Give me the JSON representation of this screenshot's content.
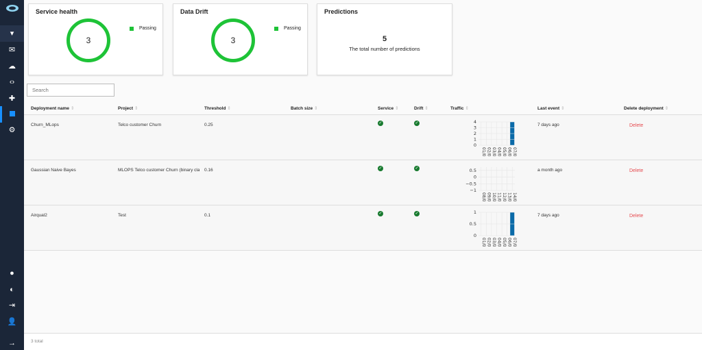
{
  "sidebar": {
    "icons": [
      "logo-icon",
      "dropdown-icon",
      "inbox-icon",
      "cloud-upload-icon",
      "code-icon",
      "puzzle-icon",
      "dashboard-icon",
      "gear-icon",
      "globe-icon",
      "contrast-icon",
      "login-icon",
      "user-icon",
      "arrow-right-icon"
    ]
  },
  "cards": {
    "service_health": {
      "title": "Service health",
      "count": "3",
      "legend": "Passing"
    },
    "data_drift": {
      "title": "Data Drift",
      "count": "3",
      "legend": "Passing"
    },
    "predictions": {
      "title": "Predictions",
      "count": "5",
      "caption": "The total number of predictions"
    }
  },
  "search": {
    "placeholder": "Search"
  },
  "columns": [
    "Deployment name",
    "Project",
    "Threshold",
    "Batch size",
    "Service",
    "Drift",
    "Traffic",
    "Last event",
    "Delete deployment"
  ],
  "rows": [
    {
      "name": "Churn_MLops",
      "project": "Telco customer Churn",
      "threshold": "0.25",
      "batch": "",
      "service": "passing",
      "drift": "passing",
      "last_event": "7 days ago",
      "delete": "Delete",
      "traffic": {
        "type": "bar",
        "x": [
          "01/0",
          "02/0",
          "03/0",
          "04/0",
          "05/0",
          "06/0",
          "07/0"
        ],
        "values": [
          0,
          0,
          0,
          0,
          0,
          0,
          4
        ],
        "yticks": [
          "0",
          "1",
          "2",
          "3",
          "4"
        ],
        "ylim": [
          0,
          4
        ]
      }
    },
    {
      "name": "Gaussian Naive Bayes",
      "project": "MLOPS Telco customer Churn (binary cla",
      "threshold": "0.16",
      "batch": "",
      "service": "passing",
      "drift": "passing",
      "last_event": "a month ago",
      "delete": "Delete",
      "traffic": {
        "type": "bar",
        "x": [
          "08/0",
          "09/0",
          "10/0",
          "11/0",
          "12/0",
          "13/0",
          "14/0"
        ],
        "values": [
          0,
          0,
          0,
          0,
          0,
          0,
          0
        ],
        "yticks": [
          "−1",
          "−0.5",
          "0",
          "0.5"
        ],
        "ylim": [
          -1,
          0.75
        ]
      }
    },
    {
      "name": "Airqual2",
      "project": "Test",
      "threshold": "0.1",
      "batch": "",
      "service": "passing",
      "drift": "passing",
      "last_event": "7 days ago",
      "delete": "Delete",
      "traffic": {
        "type": "bar",
        "x": [
          "01/0",
          "02/0",
          "03/0",
          "04/0",
          "05/0",
          "06/0",
          "07/0"
        ],
        "values": [
          0,
          0,
          0,
          0,
          0,
          0,
          1
        ],
        "yticks": [
          "0",
          "0.5",
          "1"
        ],
        "ylim": [
          0,
          1
        ]
      }
    }
  ],
  "footer": {
    "total": "3 total"
  },
  "colors": {
    "sidebar": "#1b2638",
    "passing": "#1ec337",
    "bar": "#0b6aa8",
    "delete": "#e5484d"
  }
}
